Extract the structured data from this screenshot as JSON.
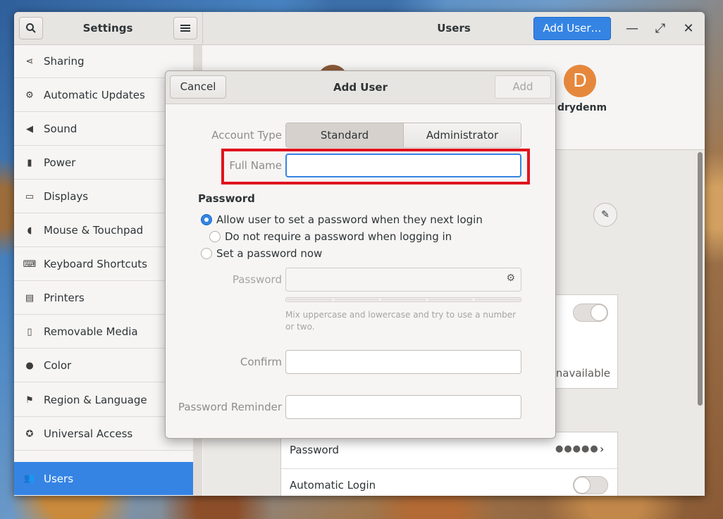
{
  "window": {
    "sidebar_title": "Settings",
    "main_title": "Users",
    "add_user_label": "Add User…",
    "minimize_glyph": "—",
    "maximize_glyph": "⤢",
    "close_glyph": "✕"
  },
  "sidebar": {
    "items": [
      {
        "label": "Sharing",
        "icon": "share-icon"
      },
      {
        "label": "Automatic Updates",
        "icon": "gear-icon"
      },
      {
        "label": "Sound",
        "icon": "speaker-icon"
      },
      {
        "label": "Power",
        "icon": "battery-icon"
      },
      {
        "label": "Displays",
        "icon": "display-icon"
      },
      {
        "label": "Mouse & Touchpad",
        "icon": "mouse-icon"
      },
      {
        "label": "Keyboard Shortcuts",
        "icon": "keyboard-icon"
      },
      {
        "label": "Printers",
        "icon": "printer-icon"
      },
      {
        "label": "Removable Media",
        "icon": "usb-icon"
      },
      {
        "label": "Color",
        "icon": "color-icon"
      },
      {
        "label": "Region & Language",
        "icon": "flag-icon"
      },
      {
        "label": "Universal Access",
        "icon": "accessibility-icon"
      },
      {
        "label": "Users",
        "icon": "users-icon",
        "active": true
      }
    ]
  },
  "background_panel": {
    "user_initial": "D",
    "user_name": "drydenm",
    "unavailable_text": "Unavailable",
    "password_label": "Password",
    "password_dots": "●●●●●",
    "auto_login_label": "Automatic Login"
  },
  "dialog": {
    "title": "Add User",
    "cancel_label": "Cancel",
    "add_label": "Add",
    "account_type_label": "Account Type",
    "account_types": [
      "Standard",
      "Administrator"
    ],
    "selected_account_type": "Standard",
    "full_name_label": "Full Name",
    "full_name_value": "",
    "password_section": "Password",
    "radio_options": [
      "Allow user to set a password when they next login",
      "Do not require a password when logging in",
      "Set a password now"
    ],
    "selected_radio_index": 0,
    "password_field_label": "Password",
    "password_hint": "Mix uppercase and lowercase and try to use a number or two.",
    "confirm_label": "Confirm",
    "reminder_label": "Password Reminder"
  },
  "colors": {
    "accent": "#3584e4",
    "highlight_box": "#e0141e",
    "avatar": "#e6883c"
  }
}
